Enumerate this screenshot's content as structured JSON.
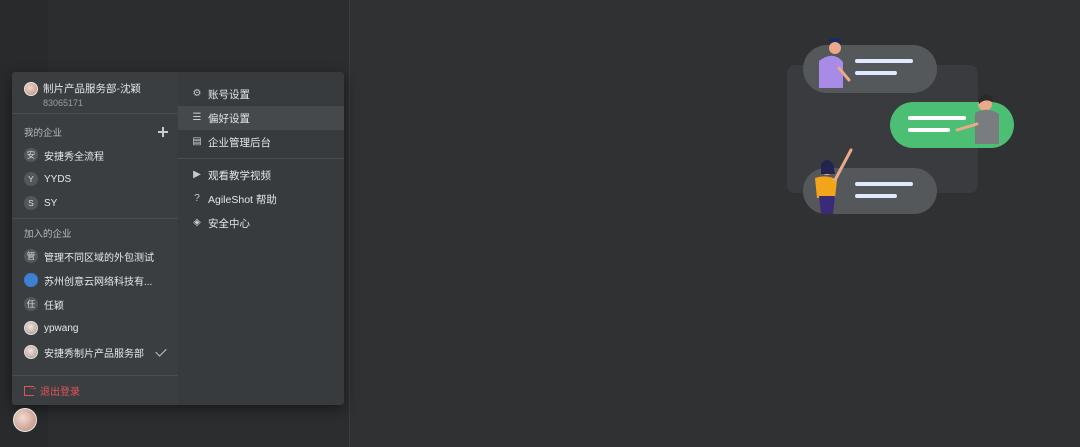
{
  "user": {
    "name": "制片产品服务部-沈颖",
    "id": "83065171"
  },
  "my_orgs": {
    "label": "我的企业",
    "items": [
      {
        "badge": "安",
        "label": "安捷秀全流程"
      },
      {
        "badge": "Y",
        "label": "YYDS"
      },
      {
        "badge": "S",
        "label": "SY"
      }
    ]
  },
  "joined_orgs": {
    "label": "加入的企业",
    "items": [
      {
        "badge": "管",
        "label": "管理不同区域的外包测试"
      },
      {
        "badge": "",
        "label": "苏州创意云网络科技有..."
      },
      {
        "badge": "任",
        "label": "任颖"
      },
      {
        "badge": "",
        "label": "ypwang"
      },
      {
        "badge": "",
        "label": "安捷秀制片产品服务部"
      }
    ]
  },
  "logout_label": "退出登录",
  "menu": [
    {
      "icon": "gear-icon",
      "label": "账号设置"
    },
    {
      "icon": "sliders-icon",
      "label": "偏好设置"
    },
    {
      "icon": "admin-icon",
      "label": "企业管理后台"
    },
    {
      "icon": "play-icon",
      "label": "观看教学视频"
    },
    {
      "icon": "help-icon",
      "label": "AgileShot 帮助"
    },
    {
      "icon": "shield-icon",
      "label": "安全中心"
    }
  ],
  "colors": {
    "accent_green": "#4cbf74",
    "danger": "#e05454",
    "bubble": "#55585b"
  }
}
